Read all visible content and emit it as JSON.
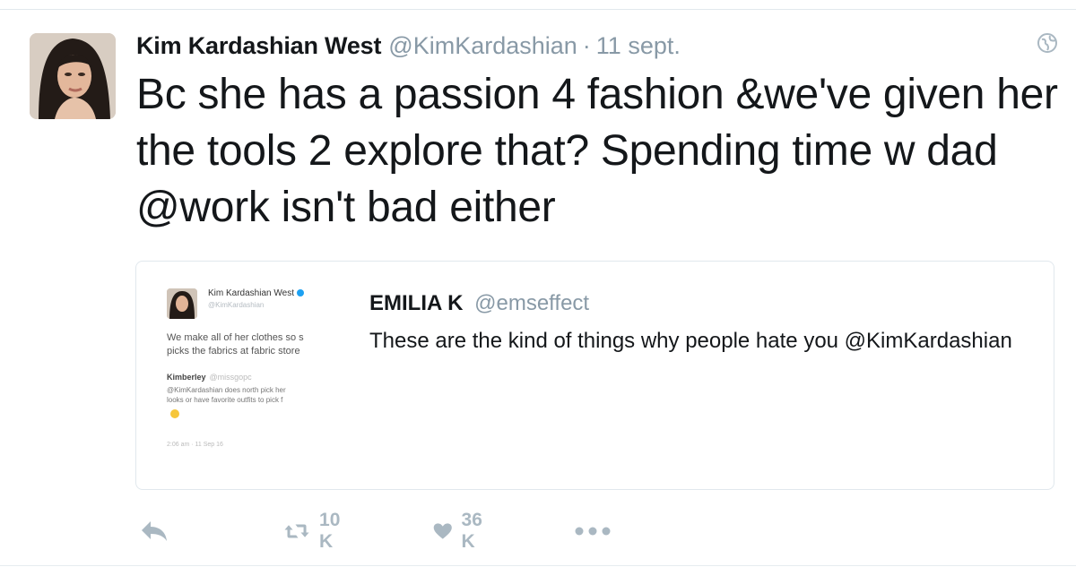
{
  "tweet": {
    "author_name": "Kim Kardashian West",
    "author_handle": "@KimKardashian",
    "separator": "·",
    "date": "11 sept.",
    "text": "Bc she has a passion 4 fashion &we've given her the tools 2 explore that? Spending time w dad @work isn't bad either"
  },
  "quoted_tweet": {
    "author_name": "EMILIA K",
    "author_handle": "@emseffect",
    "text": "These are the kind of things why people hate you @KimKardashian",
    "screenshot": {
      "name": "Kim Kardashian West",
      "handle": "@KimKardashian",
      "text_line1": "We make all of her clothes so s",
      "text_line2": "picks the fabrics at fabric store",
      "reply_name": "Kimberley",
      "reply_handle": "@missgopc",
      "reply_line1": "@KimKardashian does north pick her",
      "reply_line2": "looks or have favorite outfits to pick f",
      "time": "2:06 am · 11 Sep 16"
    }
  },
  "actions": {
    "retweet_count": "10 K",
    "like_count": "36 K"
  },
  "icons": [
    "globe-icon",
    "reply-icon",
    "retweet-icon",
    "heart-icon",
    "more-icon"
  ],
  "colors": {
    "text": "#14171a",
    "muted": "#8899a6",
    "action_gray": "#aab8c2",
    "border": "#e1e8ed"
  }
}
